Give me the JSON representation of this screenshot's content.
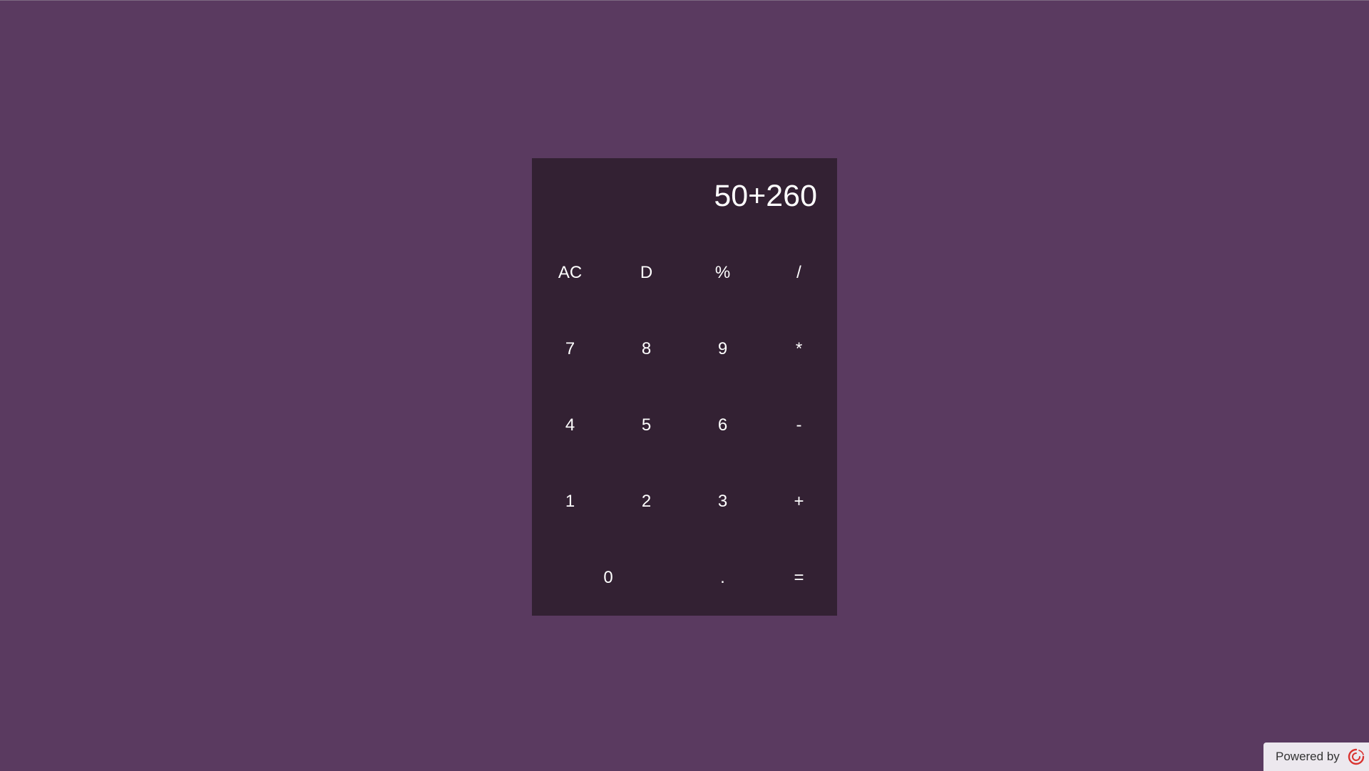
{
  "display": {
    "expression": "50+260"
  },
  "keys": [
    {
      "label": "AC",
      "name": "clear-button"
    },
    {
      "label": "D",
      "name": "delete-button"
    },
    {
      "label": "%",
      "name": "percent-button"
    },
    {
      "label": "/",
      "name": "divide-button"
    },
    {
      "label": "7",
      "name": "digit-7-button"
    },
    {
      "label": "8",
      "name": "digit-8-button"
    },
    {
      "label": "9",
      "name": "digit-9-button"
    },
    {
      "label": "*",
      "name": "multiply-button"
    },
    {
      "label": "4",
      "name": "digit-4-button"
    },
    {
      "label": "5",
      "name": "digit-5-button"
    },
    {
      "label": "6",
      "name": "digit-6-button"
    },
    {
      "label": "-",
      "name": "subtract-button"
    },
    {
      "label": "1",
      "name": "digit-1-button"
    },
    {
      "label": "2",
      "name": "digit-2-button"
    },
    {
      "label": "3",
      "name": "digit-3-button"
    },
    {
      "label": "+",
      "name": "add-button"
    },
    {
      "label": "0",
      "name": "digit-0-button"
    },
    {
      "label": ".",
      "name": "decimal-button"
    },
    {
      "label": "=",
      "name": "equals-button"
    }
  ],
  "footer": {
    "powered_by": "Powered by",
    "logo_icon": "swirl-logo-icon"
  },
  "colors": {
    "background": "#5a3a60",
    "calculator": "#332133",
    "text": "#ffffff",
    "logo": "#d9322f"
  }
}
